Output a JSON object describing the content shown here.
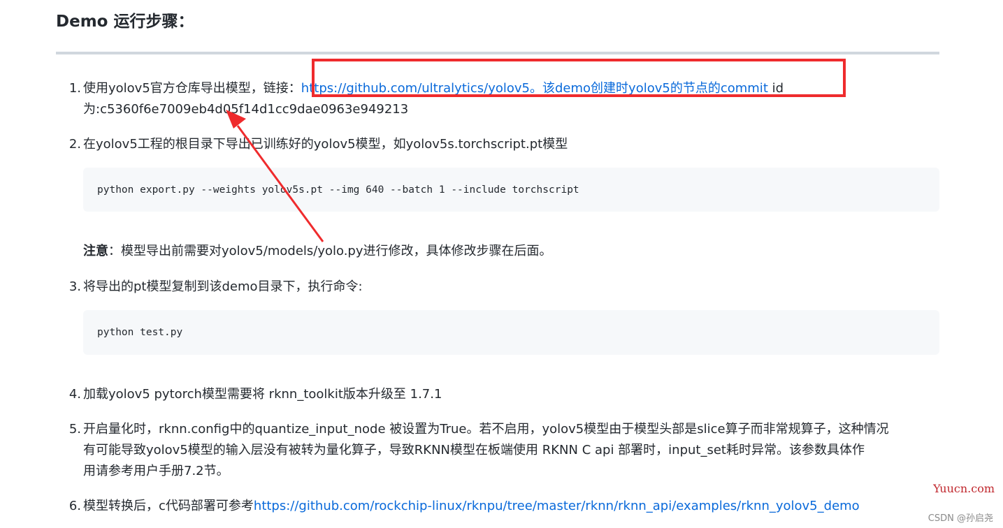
{
  "heading": "Demo 运行步骤：",
  "steps": [
    {
      "number": "1.",
      "text_prefix": "使用yolov5官方仓库导出模型，链接：",
      "link_text": "https://github.com/ultralytics/yolov5。该demo创建时yolov5的节点的commit",
      "text_suffix": " id",
      "line2": "为:c5360f6e7009eb4d05f14d1cc9dae0963e949213"
    },
    {
      "number": "2.",
      "text": "在yolov5工程的根目录下导出已训练好的yolov5模型，如yolov5s.torchscript.pt模型",
      "code": "python export.py --weights yolov5s.pt --img 640 --batch 1 --include torchscript",
      "note_label": "注意",
      "note_text": "：模型导出前需要对yolov5/models/yolo.py进行修改，具体修改步骤在后面。"
    },
    {
      "number": "3.",
      "text": "将导出的pt模型复制到该demo目录下，执行命令:",
      "code": "python test.py"
    },
    {
      "number": "4.",
      "text": "加载yolov5 pytorch模型需要将 rknn_toolkit版本升级至 1.7.1"
    },
    {
      "number": "5.",
      "line1": "开启量化时，rknn.config中的quantize_input_node 被设置为True。若不启用，yolov5模型由于模型头部是slice算子而非常规算子，这种情况",
      "line2": "有可能导致yolov5模型的输入层没有被转为量化算子，导致RKNN模型在板端使用 RKNN C api 部署时，input_set耗时异常。该参数具体作",
      "line3": "用请参考用户手册7.2节。"
    },
    {
      "number": "6.",
      "text_prefix": "模型转换后，c代码部署可参考",
      "link_text": "https://github.com/rockchip-linux/rknpu/tree/master/rknn/rknn_api/examples/rknn_yolov5_demo"
    }
  ],
  "watermark": "Yuucn.com",
  "credit": "CSDN @孙启尧",
  "colors": {
    "link": "#0969da",
    "annotation_red": "#ef2b2d",
    "code_bg": "#f6f8fa",
    "rule": "#d0d7de"
  }
}
